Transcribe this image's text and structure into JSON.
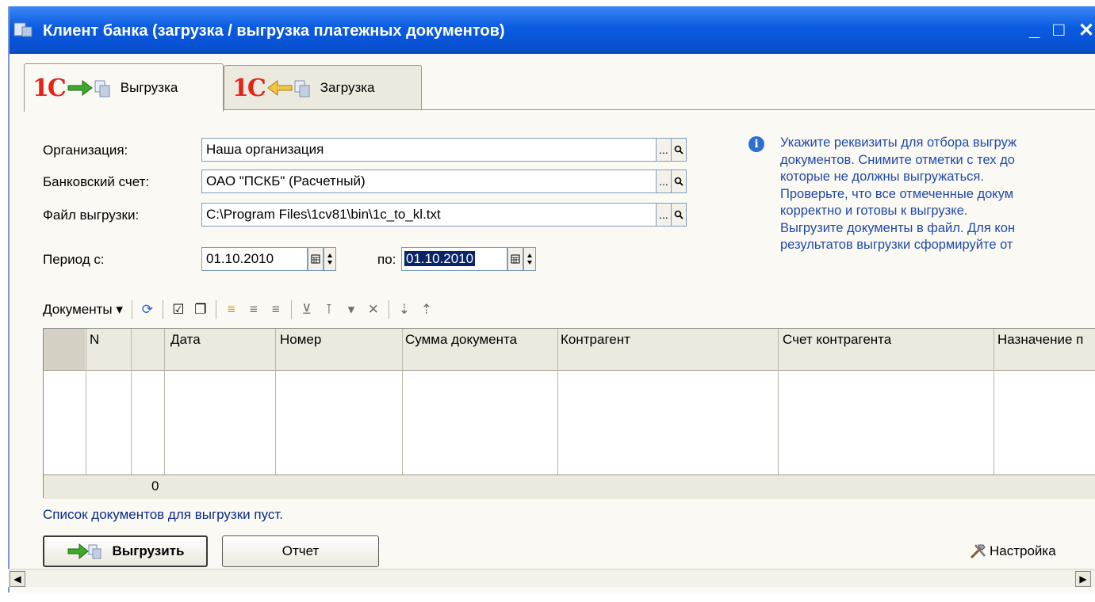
{
  "window": {
    "title": "Клиент банка (загрузка / выгрузка платежных документов)",
    "controls": [
      "_",
      "□",
      "✕"
    ]
  },
  "tabs": [
    {
      "logo": "1С",
      "label": "Выгрузка",
      "active": true
    },
    {
      "logo": "1С",
      "label": "Загрузка",
      "active": false
    }
  ],
  "form": {
    "org_label": "Организация:",
    "org_value": "Наша организация",
    "account_label": "Банковский счет:",
    "account_value": "ОАО \"ПСКБ\" (Расчетный)",
    "file_label": "Файл выгрузки:",
    "file_value": "C:\\Program Files\\1cv81\\bin\\1c_to_kl.txt",
    "period_label": "Период с:",
    "period_from": "01.10.2010",
    "period_to_label": "по:",
    "period_to": "01.10.2010",
    "ellipsis": "...",
    "search_glyph": "🔍"
  },
  "hint": {
    "lines": [
      "Укажите реквизиты для отбора выгруж",
      "документов. Снимите отметки с тех до",
      "которые не должны выгружаться.",
      "Проверьте, что все отмеченные докум",
      "корректно и готовы к выгрузке.",
      "Выгрузите документы в файл. Для кон",
      "результатов выгрузки сформируйте от"
    ]
  },
  "toolbar": {
    "menu_label": "Документы ▾"
  },
  "grid": {
    "columns": [
      "",
      "N",
      "",
      "Дата",
      "Номер",
      "Сумма документа",
      "Контрагент",
      "Счет контрагента",
      "Назначение п"
    ],
    "footer_count": "0"
  },
  "status": {
    "empty_message": "Список документов для выгрузки пуст."
  },
  "buttons": {
    "export": "Выгрузить",
    "report": "Отчет",
    "settings": "Настройка"
  }
}
